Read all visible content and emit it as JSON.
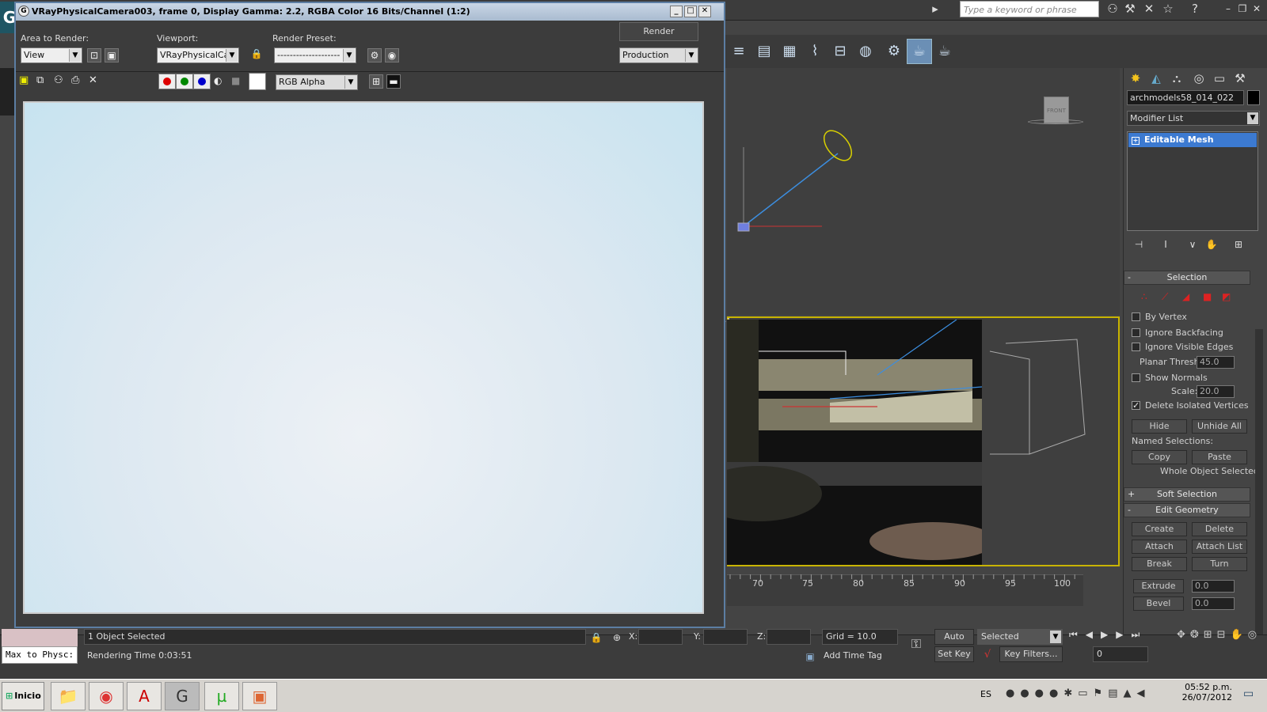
{
  "topbar": {
    "search_placeholder": "Type a keyword or phrase",
    "logo_glyph": "G"
  },
  "render_dialog": {
    "title": "VRayPhysicalCamera003, frame 0, Display Gamma: 2.2, RGBA Color 16 Bits/Channel (1:2)",
    "area_label": "Area to Render:",
    "area_value": "View",
    "viewport_label": "Viewport:",
    "viewport_value": "VRayPhysicalCam",
    "preset_label": "Render Preset:",
    "preset_value": "--------------------",
    "render_button": "Render",
    "production_value": "Production",
    "channel_value": "RGB Alpha"
  },
  "viewport": {
    "nav_label": "FRONT",
    "bottom_tag": "[+]",
    "timeline_ticks": [
      "70",
      "75",
      "80",
      "85",
      "90",
      "95",
      "100"
    ]
  },
  "command_panel": {
    "object_name": "archmodels58_014_022",
    "modifier_list": "Modifier List",
    "stack_item": "Editable Mesh",
    "selection_title": "Selection",
    "by_vertex": "By Vertex",
    "ignore_backfacing": "Ignore Backfacing",
    "ignore_visible_edges": "Ignore Visible Edges",
    "planar_thresh_label": "Planar Thresh:",
    "planar_thresh_value": "45.0",
    "show_normals": "Show Normals",
    "scale_label": "Scale:",
    "scale_value": "20.0",
    "delete_isolated": "Delete Isolated Vertices",
    "hide": "Hide",
    "unhide_all": "Unhide All",
    "named_selections": "Named Selections:",
    "copy": "Copy",
    "paste": "Paste",
    "whole_object": "Whole Object Selected",
    "soft_selection": "Soft Selection",
    "edit_geometry": "Edit Geometry",
    "create": "Create",
    "delete": "Delete",
    "attach": "Attach",
    "attach_list": "Attach List",
    "break": "Break",
    "turn": "Turn",
    "extrude": "Extrude",
    "extrude_value": "0.0",
    "bevel": "Bevel",
    "bevel_value": "0.0"
  },
  "status_bar": {
    "script_label": "Max to Physc:",
    "selection_text": "1 Object Selected",
    "render_time": "Rendering Time  0:03:51",
    "x_label": "X:",
    "y_label": "Y:",
    "z_label": "Z:",
    "grid": "Grid = 10.0",
    "add_time_tag": "Add Time Tag",
    "auto_key": "Auto Key",
    "set_key": "Set Key",
    "selected_value": "Selected",
    "key_filters": "Key Filters...",
    "frame_value": "0"
  },
  "taskbar": {
    "start_label": "Inicio",
    "language": "ES",
    "time": "05:52 p.m.",
    "date": "26/07/2012"
  }
}
